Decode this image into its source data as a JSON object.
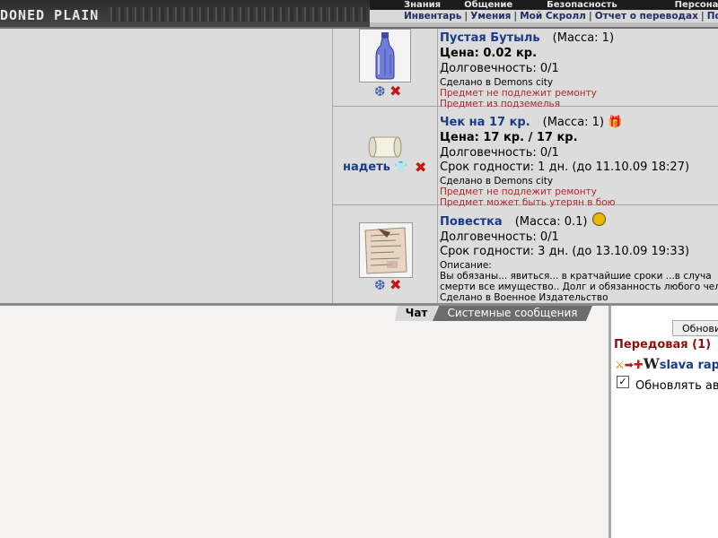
{
  "header": {
    "logo_text": "DONED PLAIN",
    "top_menu": [
      "Знания",
      "Общение",
      "Безопасность",
      "Персонаж"
    ],
    "sub_menu": [
      "Инвентарь",
      "Умения",
      "Мой Скролл",
      "Отчет о переводах",
      "Пое"
    ]
  },
  "inventory": [
    {
      "name": "Пустая Бутыль",
      "mass": "(Масса: 1)",
      "price": "Цена: 0.02 кр.",
      "durability": "Долговечность: 0/1",
      "made": "Сделано в Demons city",
      "notes": [
        "Предмет не подлежит ремонту",
        "Предмет из подземелья"
      ],
      "icon": "bottle-icon"
    },
    {
      "name": "Чек на 17 кр.",
      "mass": "(Масса: 1)",
      "price": "Цена: 17 кр. / 17 кр.",
      "durability": "Долговечность: 0/1",
      "expiry": "Срок годности: 1 дн. (до 11.10.09 18:27)",
      "made": "Сделано в Demons city",
      "notes": [
        "Предмет не подлежит ремонту",
        "Предмет может быть утерян в бою"
      ],
      "wear_label": "надеть",
      "icon": "scroll-icon"
    },
    {
      "name": "Повестка",
      "mass": "(Масса: 0.1)",
      "durability": "Долговечность: 0/1",
      "expiry": "Срок годности: 3 дн. (до 13.10.09 19:33)",
      "desc_label": "Описание:",
      "desc_lines": [
        "Вы обязаны... явиться... в кратчайшие сроки ...в случа",
        "смерти все имущество.. Долг и обязанность любого чел"
      ],
      "made": "Сделано в Военное Издательство",
      "icon": "notice-paper-icon"
    }
  ],
  "chat": {
    "tabs": [
      "Чат",
      "Системные сообщения"
    ]
  },
  "right_panel": {
    "refresh_button": "Обновить",
    "location": "Передовая (1)",
    "user_name": "slava rap",
    "user_clan_letter": "W",
    "auto_refresh_label": "Обновлять авт",
    "auto_refresh_mark": "✓"
  },
  "colors": {
    "link_blue": "#1a3a8a",
    "warning_red": "#b3262b",
    "location_red": "#8b1111"
  }
}
